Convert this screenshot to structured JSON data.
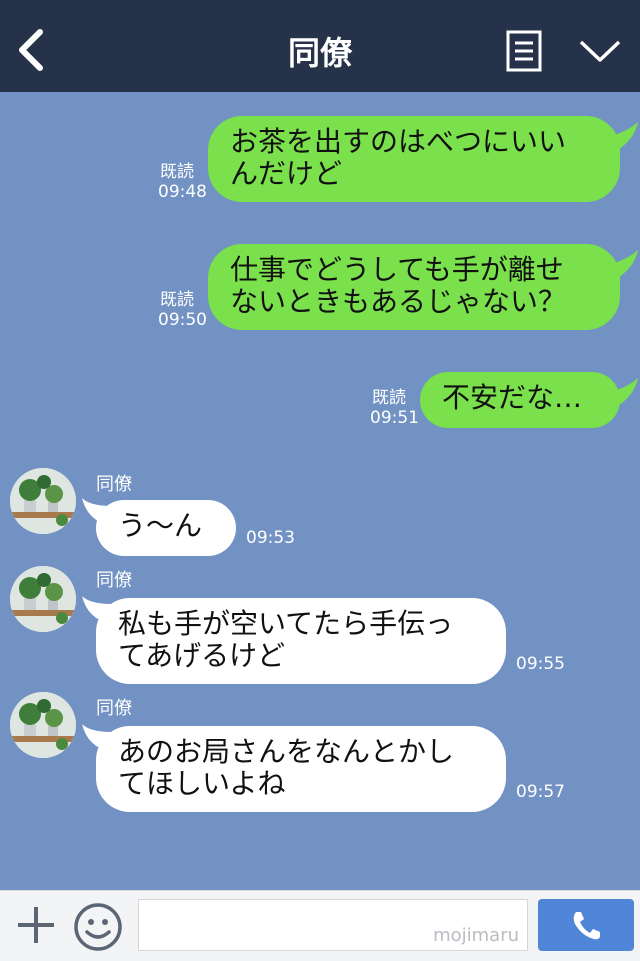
{
  "header": {
    "title": "同僚"
  },
  "messages_out": [
    {
      "text": "お茶を出すのはべつにいい\nんだけど",
      "read": "既読",
      "time": "09:48"
    },
    {
      "text": "仕事でどうしても手が離せ\nないときもあるじゃない？",
      "read": "既読",
      "time": "09:50"
    },
    {
      "text": "不安だな…",
      "read": "既読",
      "time": "09:51"
    }
  ],
  "messages_in": [
    {
      "sender": "同僚",
      "text": "う～ん",
      "time": "09:53"
    },
    {
      "sender": "同僚",
      "text": "私も手が空いてたら手伝っ\nてあげるけど",
      "time": "09:55"
    },
    {
      "sender": "同僚",
      "text": "あのお局さんをなんとかし\nてほしいよね",
      "time": "09:57"
    }
  ],
  "input": {
    "watermark": "mojimaru"
  },
  "colors": {
    "header": "#263249",
    "background": "#7292c3",
    "out_bubble": "#7ae04b",
    "in_bubble": "#ffffff",
    "send": "#4f86d8"
  }
}
